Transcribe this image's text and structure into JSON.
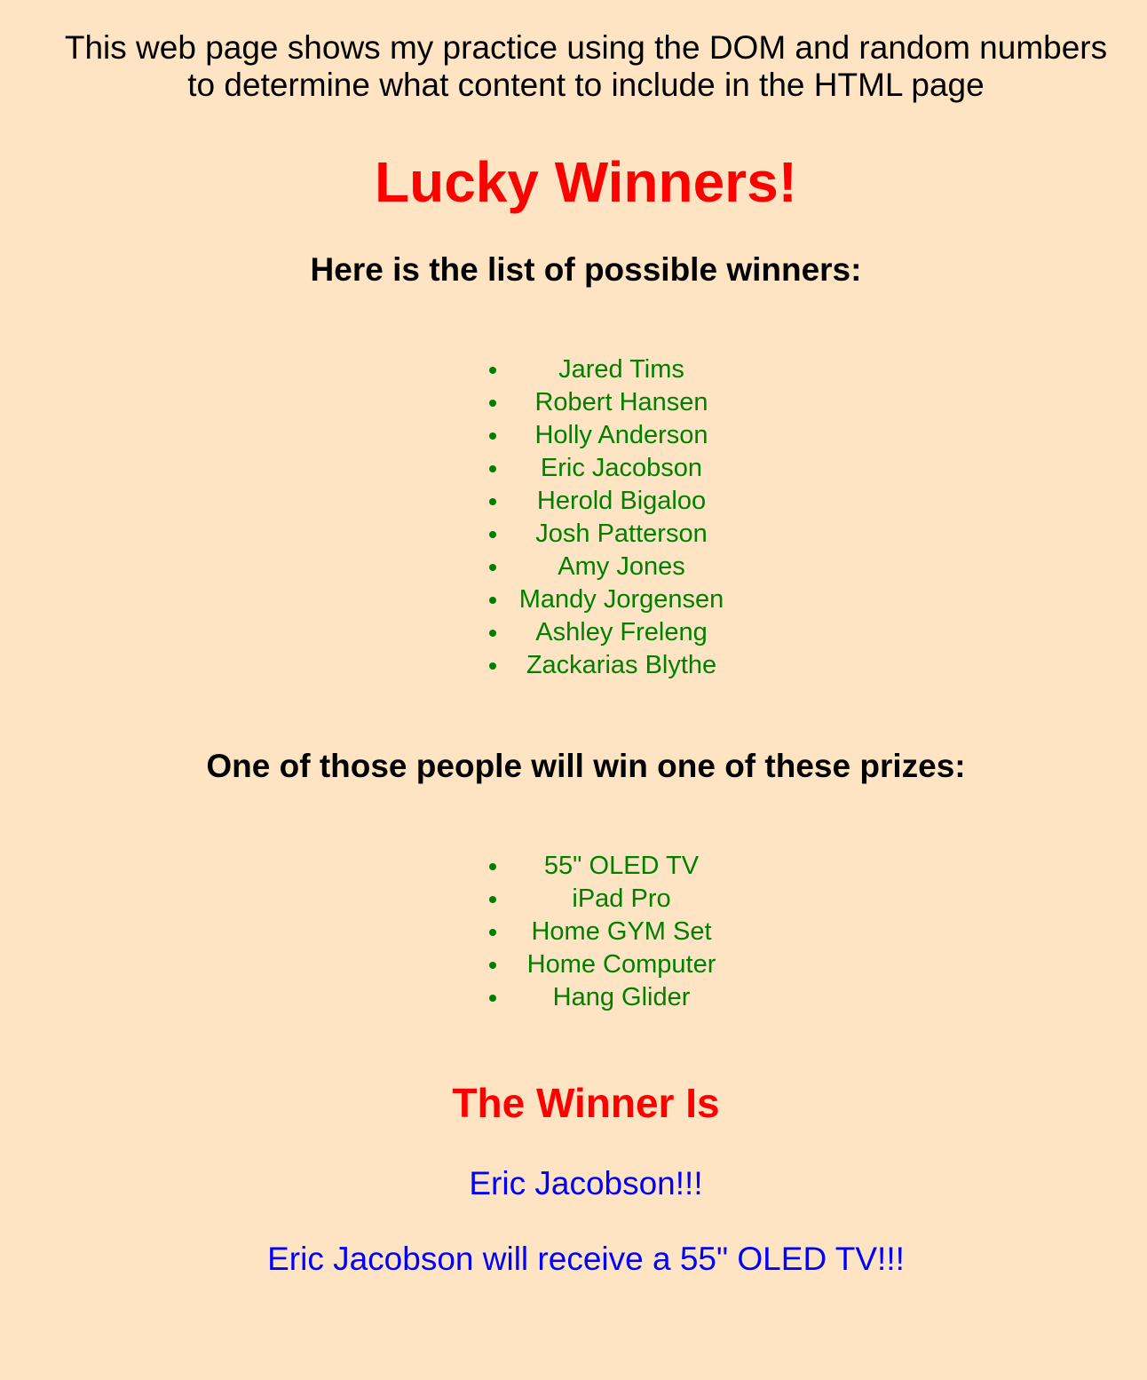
{
  "intro": "This web page shows my practice using the DOM and random numbers to determine what content to include in the HTML page",
  "title": "Lucky Winners!",
  "winners_heading": "Here is the list of possible winners:",
  "winners": [
    "Jared Tims",
    "Robert Hansen",
    "Holly Anderson",
    "Eric Jacobson",
    "Herold Bigaloo",
    "Josh Patterson",
    "Amy Jones",
    "Mandy Jorgensen",
    "Ashley Freleng",
    "Zackarias Blythe"
  ],
  "prizes_heading": "One of those people will win one of these prizes:",
  "prizes": [
    "55\" OLED TV",
    "iPad Pro",
    "Home GYM Set",
    "Home Computer",
    "Hang Glider"
  ],
  "winner_heading": "The Winner Is",
  "winner_name": "Eric Jacobson!!!",
  "winner_prize": "Eric Jacobson will receive a 55\" OLED TV!!!",
  "colors": {
    "background": "#ffe4c4",
    "heading_red": "#ff0000",
    "list_green": "#008000",
    "result_blue": "#0000ff"
  }
}
